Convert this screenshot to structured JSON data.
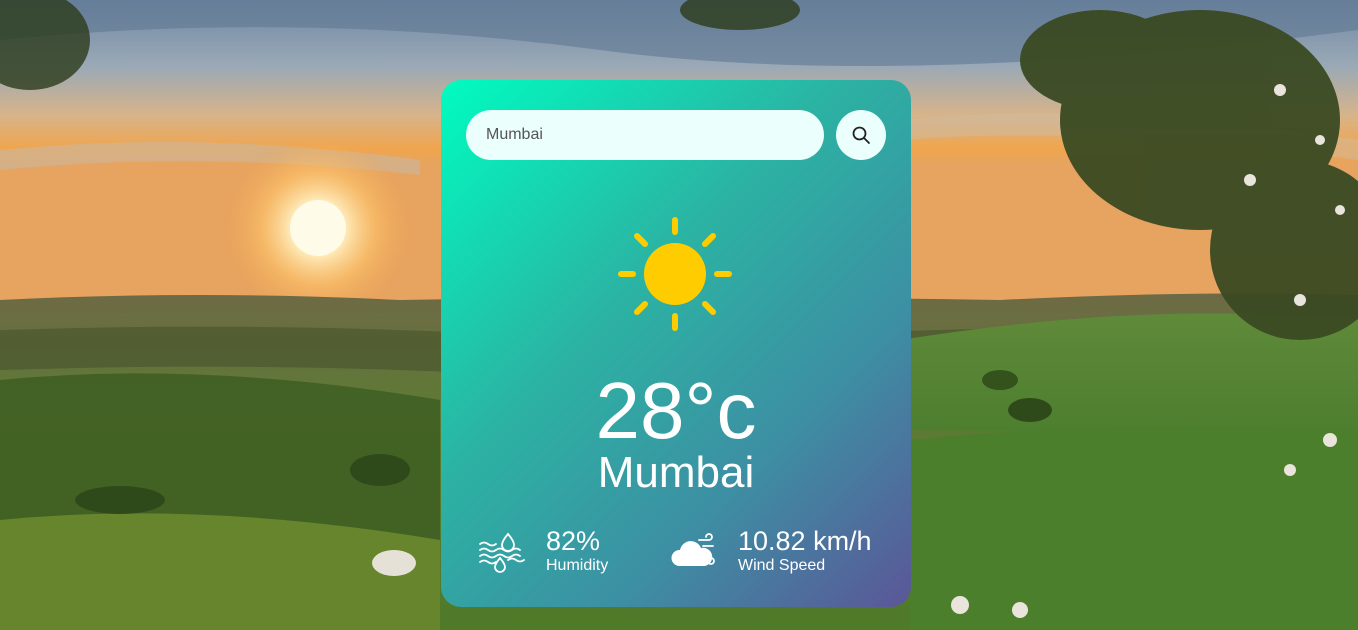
{
  "search": {
    "value": "Mumbai"
  },
  "weather": {
    "condition_icon": "sun-icon",
    "temperature": "28°c",
    "city": "Mumbai"
  },
  "details": {
    "humidity": {
      "value": "82%",
      "label": "Humidity",
      "icon": "humidity-icon"
    },
    "wind": {
      "value": "10.82 km/h",
      "label": "Wind Speed",
      "icon": "wind-icon"
    }
  },
  "colors": {
    "card_gradient_start": "#00fcc0",
    "card_gradient_end": "#5b5698",
    "sun": "#ffcc00",
    "input_bg": "#ebfffc"
  }
}
